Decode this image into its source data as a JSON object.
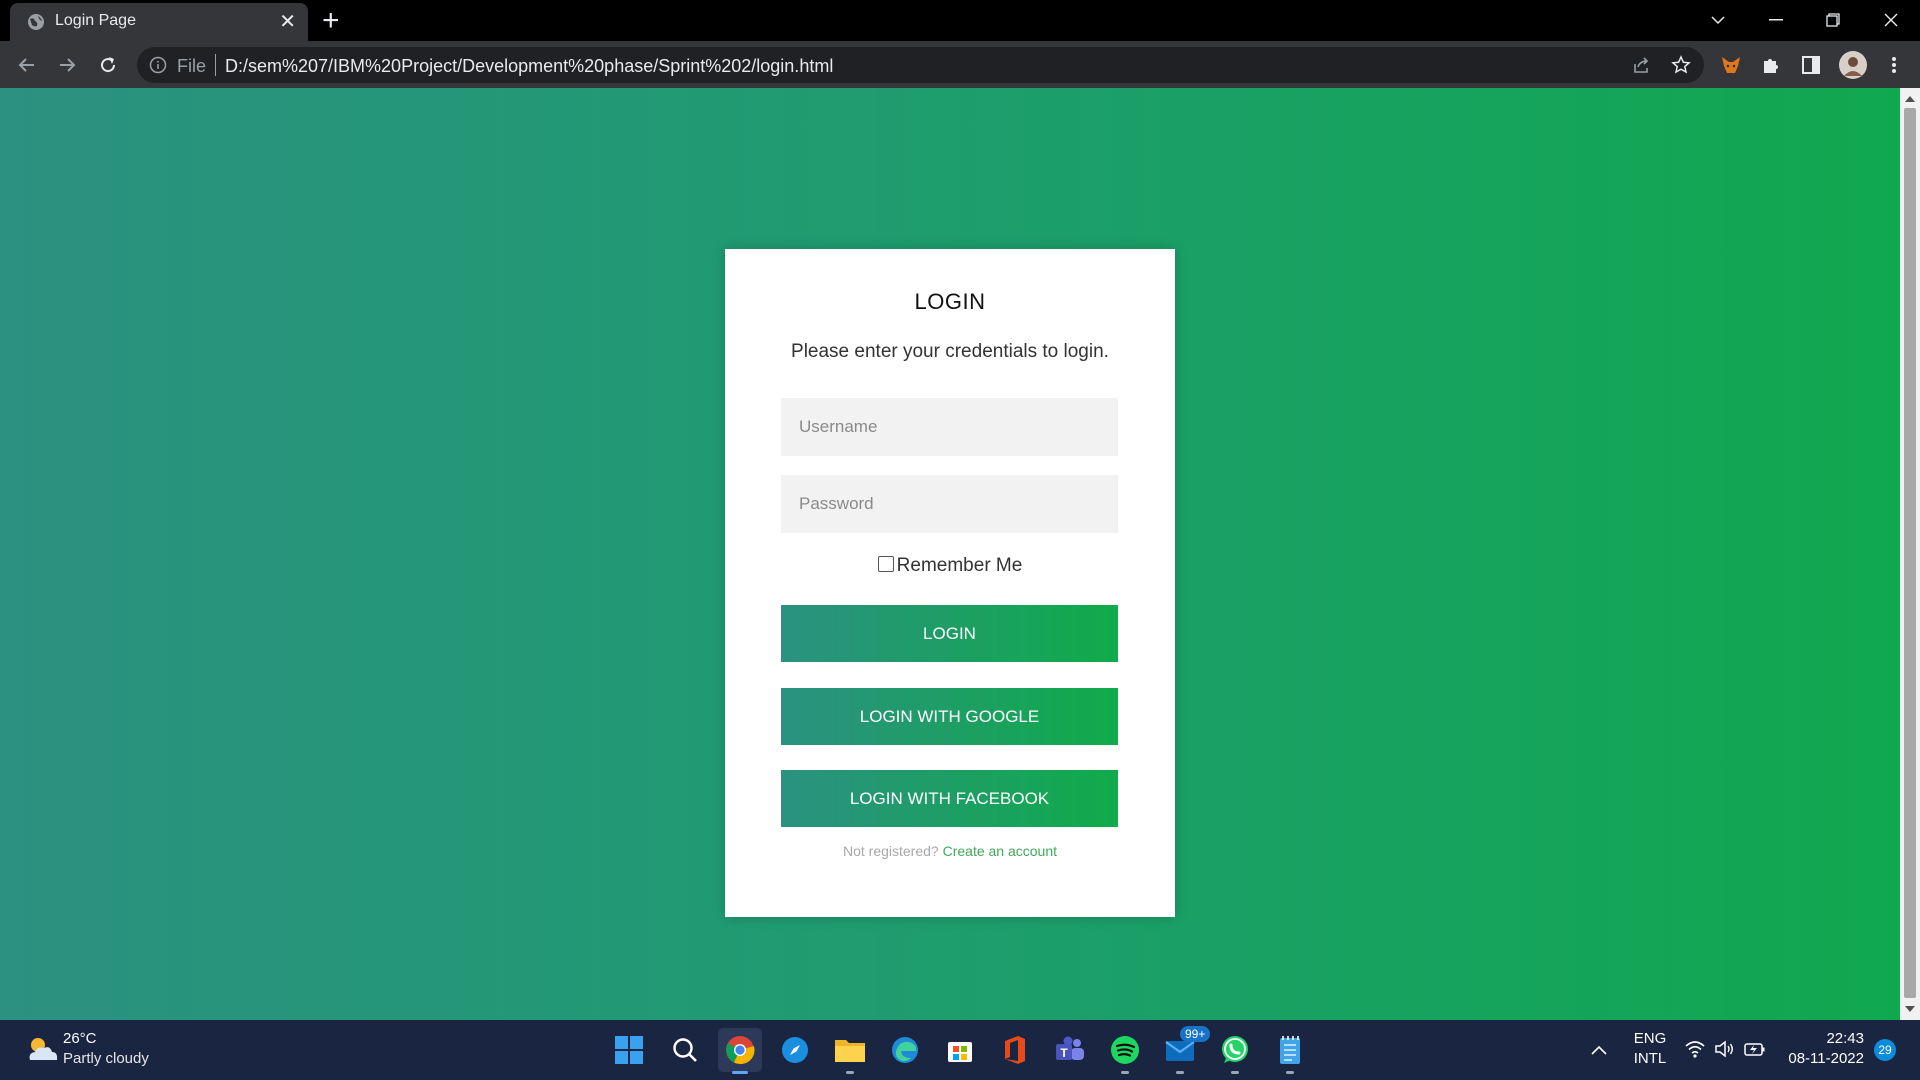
{
  "browser": {
    "tab_title": "Login Page",
    "url_scheme_label": "File",
    "url": "D:/sem%207/IBM%20Project/Development%20phase/Sprint%202/login.html"
  },
  "login": {
    "heading": "LOGIN",
    "subtitle": "Please enter your credentials to login.",
    "username_placeholder": "Username",
    "password_placeholder": "Password",
    "remember_label": "Remember Me",
    "remember_checked": false,
    "login_button": "LOGIN",
    "google_button": "LOGIN WITH GOOGLE",
    "facebook_button": "LOGIN WITH FACEBOOK",
    "not_registered": "Not registered?",
    "create_account": "Create an account"
  },
  "colors": {
    "gradient_start": "#2b9180",
    "gradient_end": "#10a84f",
    "link": "#3faa58"
  },
  "taskbar": {
    "weather_temp": "26°C",
    "weather_desc": "Partly cloudy",
    "mail_badge": "99+",
    "language": "ENG",
    "keyboard_layout": "INTL",
    "time": "22:43",
    "date": "08-11-2022",
    "notification_count": "29",
    "apps": [
      "start-icon",
      "search-icon",
      "chrome-icon",
      "safari-icon",
      "file-explorer-icon",
      "edge-icon",
      "microsoft-store-icon",
      "office-icon",
      "teams-icon",
      "spotify-icon",
      "mail-icon",
      "whatsapp-icon",
      "notepad-icon"
    ]
  }
}
